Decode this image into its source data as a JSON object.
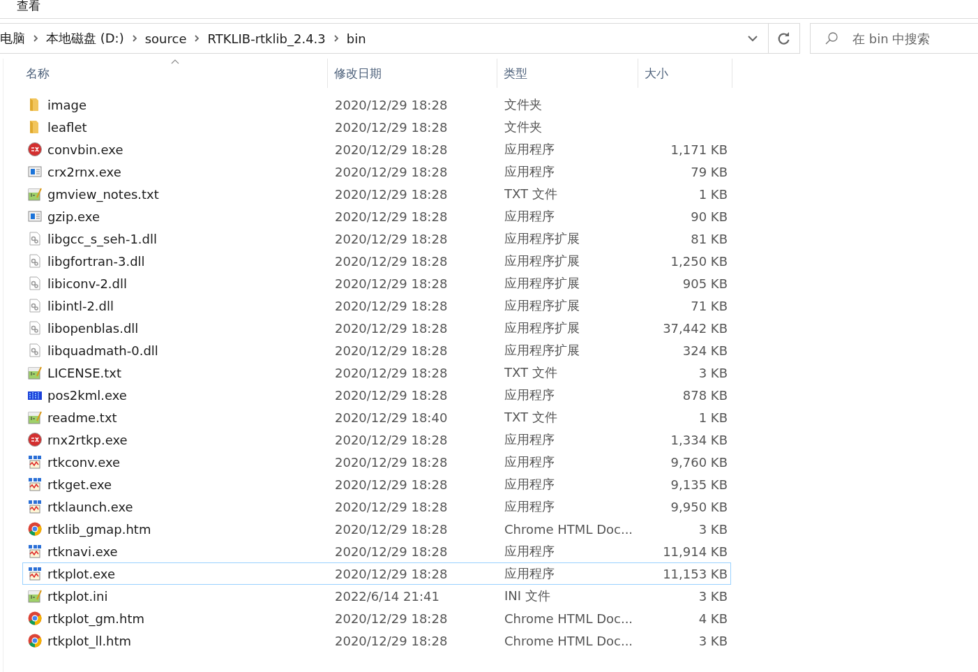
{
  "menu": {
    "label": "查看"
  },
  "breadcrumb": [
    "电脑",
    "本地磁盘 (D:)",
    "source",
    "RTKLIB-rtklib_2.4.3",
    "bin"
  ],
  "search": {
    "placeholder": "在 bin 中搜索"
  },
  "columns": [
    {
      "label": "名称",
      "sorted": true
    },
    {
      "label": "修改日期",
      "sorted": false
    },
    {
      "label": "类型",
      "sorted": false
    },
    {
      "label": "大小",
      "sorted": false
    }
  ],
  "rows": [
    {
      "name": "image",
      "kind": "folder",
      "date": "2020/12/29 18:28",
      "type": "文件夹",
      "size": "",
      "selected": false
    },
    {
      "name": "leaflet",
      "kind": "folder",
      "date": "2020/12/29 18:28",
      "type": "文件夹",
      "size": "",
      "selected": false
    },
    {
      "name": "convbin.exe",
      "kind": "cx",
      "date": "2020/12/29 18:28",
      "type": "应用程序",
      "size": "1,171 KB",
      "selected": false
    },
    {
      "name": "crx2rnx.exe",
      "kind": "window",
      "date": "2020/12/29 18:28",
      "type": "应用程序",
      "size": "79 KB",
      "selected": false
    },
    {
      "name": "gmview_notes.txt",
      "kind": "text",
      "date": "2020/12/29 18:28",
      "type": "TXT 文件",
      "size": "1 KB",
      "selected": false
    },
    {
      "name": "gzip.exe",
      "kind": "window",
      "date": "2020/12/29 18:28",
      "type": "应用程序",
      "size": "90 KB",
      "selected": false
    },
    {
      "name": "libgcc_s_seh-1.dll",
      "kind": "dll",
      "date": "2020/12/29 18:28",
      "type": "应用程序扩展",
      "size": "81 KB",
      "selected": false
    },
    {
      "name": "libgfortran-3.dll",
      "kind": "dll",
      "date": "2020/12/29 18:28",
      "type": "应用程序扩展",
      "size": "1,250 KB",
      "selected": false
    },
    {
      "name": "libiconv-2.dll",
      "kind": "dll",
      "date": "2020/12/29 18:28",
      "type": "应用程序扩展",
      "size": "905 KB",
      "selected": false
    },
    {
      "name": "libintl-2.dll",
      "kind": "dll",
      "date": "2020/12/29 18:28",
      "type": "应用程序扩展",
      "size": "71 KB",
      "selected": false
    },
    {
      "name": "libopenblas.dll",
      "kind": "dll",
      "date": "2020/12/29 18:28",
      "type": "应用程序扩展",
      "size": "37,442 KB",
      "selected": false
    },
    {
      "name": "libquadmath-0.dll",
      "kind": "dll",
      "date": "2020/12/29 18:28",
      "type": "应用程序扩展",
      "size": "324 KB",
      "selected": false
    },
    {
      "name": "LICENSE.txt",
      "kind": "text",
      "date": "2020/12/29 18:28",
      "type": "TXT 文件",
      "size": "3 KB",
      "selected": false
    },
    {
      "name": "pos2kml.exe",
      "kind": "grid",
      "date": "2020/12/29 18:28",
      "type": "应用程序",
      "size": "878 KB",
      "selected": false
    },
    {
      "name": "readme.txt",
      "kind": "text",
      "date": "2020/12/29 18:40",
      "type": "TXT 文件",
      "size": "1 KB",
      "selected": false
    },
    {
      "name": "rnx2rtkp.exe",
      "kind": "cx",
      "date": "2020/12/29 18:28",
      "type": "应用程序",
      "size": "1,334 KB",
      "selected": false
    },
    {
      "name": "rtkconv.exe",
      "kind": "rtk",
      "date": "2020/12/29 18:28",
      "type": "应用程序",
      "size": "9,760 KB",
      "selected": false
    },
    {
      "name": "rtkget.exe",
      "kind": "rtk",
      "date": "2020/12/29 18:28",
      "type": "应用程序",
      "size": "9,135 KB",
      "selected": false
    },
    {
      "name": "rtklaunch.exe",
      "kind": "rtk",
      "date": "2020/12/29 18:28",
      "type": "应用程序",
      "size": "9,950 KB",
      "selected": false
    },
    {
      "name": "rtklib_gmap.htm",
      "kind": "chrome",
      "date": "2020/12/29 18:28",
      "type": "Chrome HTML Doc...",
      "size": "3 KB",
      "selected": false
    },
    {
      "name": "rtknavi.exe",
      "kind": "rtk",
      "date": "2020/12/29 18:28",
      "type": "应用程序",
      "size": "11,914 KB",
      "selected": false
    },
    {
      "name": "rtkplot.exe",
      "kind": "rtk",
      "date": "2020/12/29 18:28",
      "type": "应用程序",
      "size": "11,153 KB",
      "selected": true
    },
    {
      "name": "rtkplot.ini",
      "kind": "text",
      "date": "2022/6/14 21:41",
      "type": "INI 文件",
      "size": "3 KB",
      "selected": false
    },
    {
      "name": "rtkplot_gm.htm",
      "kind": "chrome",
      "date": "2020/12/29 18:28",
      "type": "Chrome HTML Doc...",
      "size": "4 KB",
      "selected": false
    },
    {
      "name": "rtkplot_ll.htm",
      "kind": "chrome",
      "date": "2020/12/29 18:28",
      "type": "Chrome HTML Doc...",
      "size": "3 KB",
      "selected": false
    }
  ]
}
